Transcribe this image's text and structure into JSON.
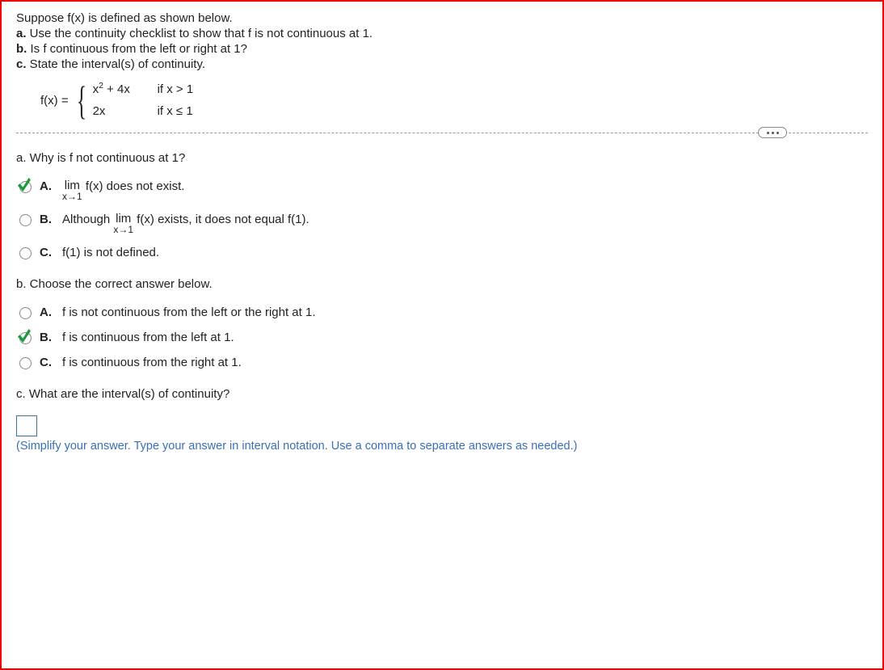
{
  "intro": {
    "line0": "Suppose f(x) is defined as shown below.",
    "a_bold": "a.",
    "a_text": " Use the continuity checklist to show that f is not continuous at 1.",
    "b_bold": "b.",
    "b_text": " Is f continuous from the left or right at 1?",
    "c_bold": "c.",
    "c_text": " State the interval(s) of continuity."
  },
  "func": {
    "label": "f(x) =",
    "case1_expr_pre": "x",
    "case1_expr_sup": "2",
    "case1_expr_post": " + 4x",
    "case1_cond": "if x > 1",
    "case2_expr": "2x",
    "case2_cond": "if x ≤ 1"
  },
  "partA": {
    "prompt_bold": "a.",
    "prompt_text": " Why is f not continuous at 1?",
    "options": {
      "A": {
        "letter": "A.",
        "lim": "lim",
        "sub": "x→1",
        "rest": " f(x) does not exist."
      },
      "B": {
        "letter": "B.",
        "pre": "Although  ",
        "lim": "lim",
        "sub": "x→1",
        "rest": " f(x) exists, it does not equal f(1)."
      },
      "C": {
        "letter": "C.",
        "text": "f(1) is not defined."
      }
    }
  },
  "partB": {
    "prompt_bold": "b.",
    "prompt_text": " Choose the correct answer below.",
    "options": {
      "A": {
        "letter": "A.",
        "text": "f is not continuous from the left or the right at 1."
      },
      "B": {
        "letter": "B.",
        "text": "f is continuous from the left at 1."
      },
      "C": {
        "letter": "C.",
        "text": "f is continuous from the right at 1."
      }
    }
  },
  "partC": {
    "prompt_bold": "c.",
    "prompt_text": " What are the interval(s) of continuity?",
    "hint": "(Simplify your answer. Type your answer in interval notation. Use a comma to separate answers as needed.)"
  }
}
